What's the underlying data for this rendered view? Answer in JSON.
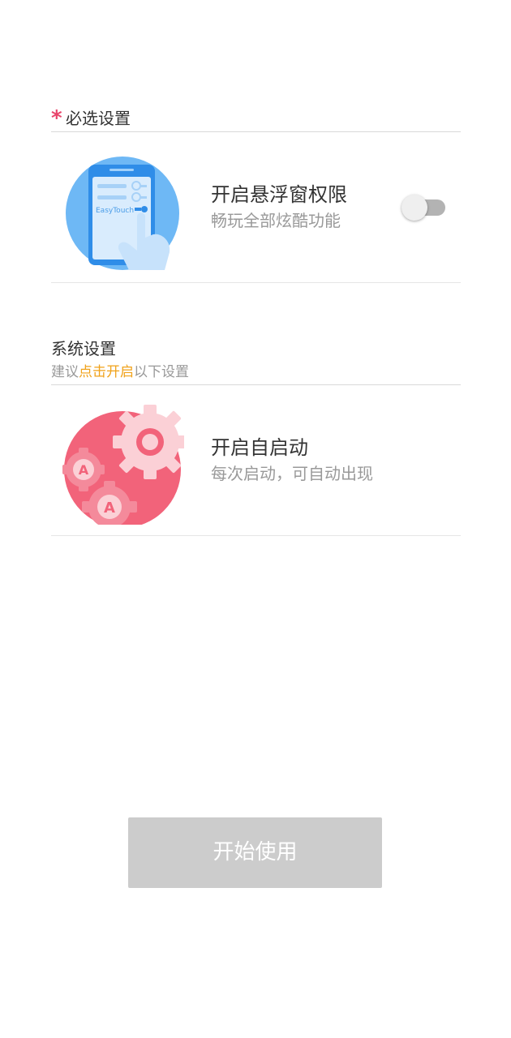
{
  "required_section": {
    "star": "*",
    "title": "必选设置"
  },
  "float_window": {
    "title": "开启悬浮窗权限",
    "subtitle": "畅玩全部炫酷功能",
    "illustration_text": "EasyTouch",
    "toggle_on": false,
    "illustration_icon": "phone-hand-icon"
  },
  "system_section": {
    "title": "系统设置",
    "hint_prefix": "建议",
    "hint_highlight": "点击开启",
    "hint_suffix": "以下设置"
  },
  "auto_start": {
    "title": "开启自启动",
    "subtitle": "每次启动，可自动出现",
    "illustration_icon": "gears-icon",
    "gear_letter": "A"
  },
  "start_button": {
    "label": "开始使用"
  },
  "colors": {
    "accent_star": "#e8456b",
    "hint_highlight": "#f0a21a",
    "button_disabled": "#cccccc",
    "float_circle": "#6eb8f5",
    "gear_circle": "#f2637a"
  }
}
